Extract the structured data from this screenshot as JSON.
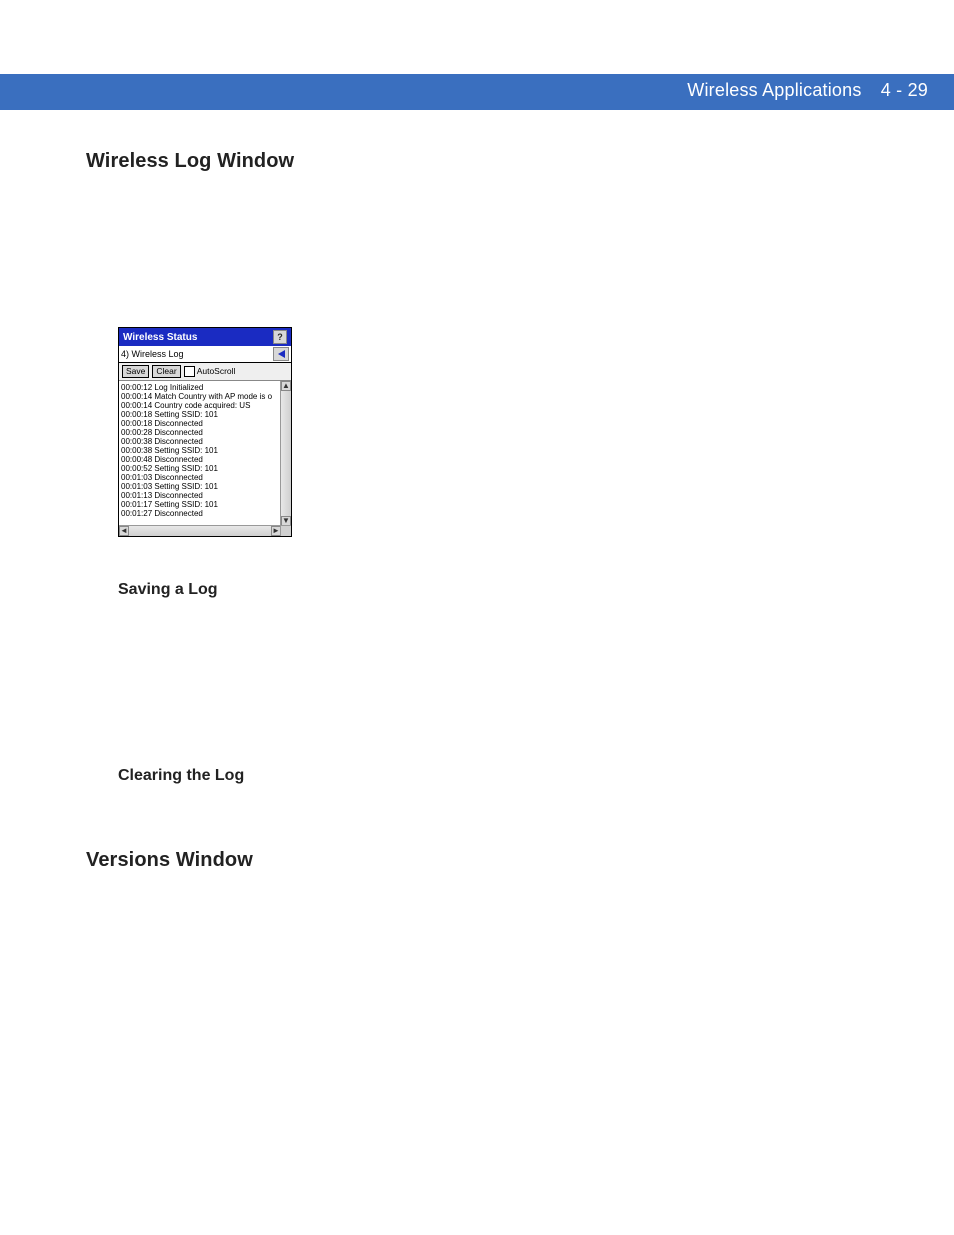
{
  "header": {
    "chapter": "Wireless Applications",
    "page": "4 - 29"
  },
  "sections": [
    {
      "title": "Wireless Log Window",
      "subs": [
        "Saving a Log",
        "Clearing the Log"
      ]
    },
    {
      "title": "Versions Window"
    }
  ],
  "shot": {
    "title": "Wireless Status",
    "tab": "4) Wireless Log",
    "toolbar": {
      "save": "Save",
      "clear": "Clear",
      "autoscroll": "AutoScroll"
    },
    "log": [
      {
        "t": "00:00:12",
        "m": "Log Initialized"
      },
      {
        "t": "00:00:14",
        "m": "Match Country with AP mode is o"
      },
      {
        "t": "00:00:14",
        "m": "Country code acquired: US"
      },
      {
        "t": "00:00:18",
        "m": "Setting SSID:  101"
      },
      {
        "t": "00:00:18",
        "m": "Disconnected"
      },
      {
        "t": "00:00:28",
        "m": "Disconnected"
      },
      {
        "t": "00:00:38",
        "m": "Disconnected"
      },
      {
        "t": "00:00:38",
        "m": "Setting SSID:  101"
      },
      {
        "t": "00:00:48",
        "m": "Disconnected"
      },
      {
        "t": "00:00:52",
        "m": "Setting SSID:  101"
      },
      {
        "t": "00:01:03",
        "m": "Disconnected"
      },
      {
        "t": "00:01:03",
        "m": "Setting SSID:  101"
      },
      {
        "t": "00:01:13",
        "m": "Disconnected"
      },
      {
        "t": "00:01:17",
        "m": "Setting SSID:  101"
      },
      {
        "t": "00:01:27",
        "m": "Disconnected"
      }
    ]
  }
}
